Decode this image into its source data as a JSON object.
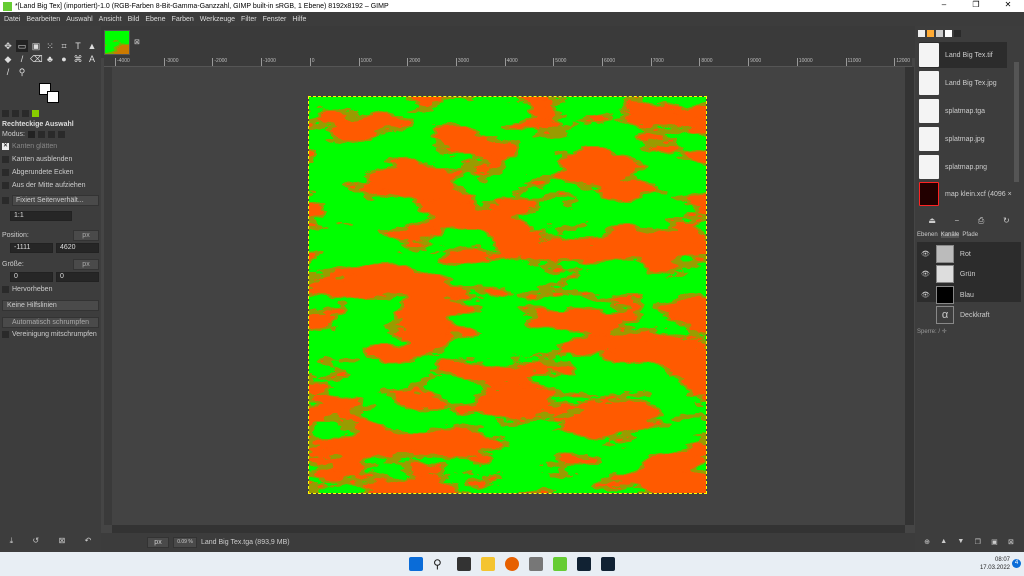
{
  "window": {
    "title": "*[Land Big Tex] (importiert)-1.0 (RGB-Farben 8-Bit-Gamma-Ganzzahl, GIMP built-in sRGB, 1 Ebene) 8192x8192 – GIMP",
    "minimize": "–",
    "maximize": "❐",
    "close": "✕"
  },
  "menu": [
    "Datei",
    "Bearbeiten",
    "Auswahl",
    "Ansicht",
    "Bild",
    "Ebene",
    "Farben",
    "Werkzeuge",
    "Filter",
    "Fenster",
    "Hilfe"
  ],
  "tool_options": {
    "title": "Rechteckige Auswahl",
    "mode_label": "Modus:",
    "antialias": "Kanten glätten",
    "feather": "Kanten ausblenden",
    "rounded": "Abgerundete Ecken",
    "expand_center": "Aus der Mitte aufziehen",
    "fixed": "Fixiert Seitenverhält...",
    "ratio": "1:1",
    "position_label": "Position:",
    "unit": "px",
    "pos_x": "-1111",
    "pos_y": "4620",
    "size_label": "Größe:",
    "size_w": "0",
    "size_h": "0",
    "highlight": "Hervorheben",
    "guides": "Keine Hilfslinien",
    "autoshrink": "Automatisch schrumpfen",
    "shrink_merged": "Vereinigung mitschrumpfen"
  },
  "ruler": [
    "-4000",
    "-3000",
    "-2000",
    "-1000",
    "0",
    "1000",
    "2000",
    "3000",
    "4000",
    "5000",
    "6000",
    "7000",
    "8000",
    "9000",
    "10000",
    "11000",
    "12000"
  ],
  "status": {
    "unit": "px",
    "zoom": "0.09 %",
    "file": "Land Big Tex.tga (893,9 MB)"
  },
  "documents": [
    "Land Big Tex.tif",
    "Land Big Tex.jpg",
    "splatmap.tga",
    "splatmap.jpg",
    "splatmap.png",
    "map klein.xcf (4096 ×"
  ],
  "dock_tabs": [
    "Ebenen",
    "Kanäle",
    "Pfade"
  ],
  "channels": [
    "Rot",
    "Grün",
    "Blau",
    "Deckkraft"
  ],
  "lock_label": "Sperre:",
  "taskbar": {
    "time": "08:07",
    "date": "17.03.2022",
    "badge": "4"
  },
  "colors": {
    "green": "#00ff00",
    "red": "#ff1a00"
  }
}
